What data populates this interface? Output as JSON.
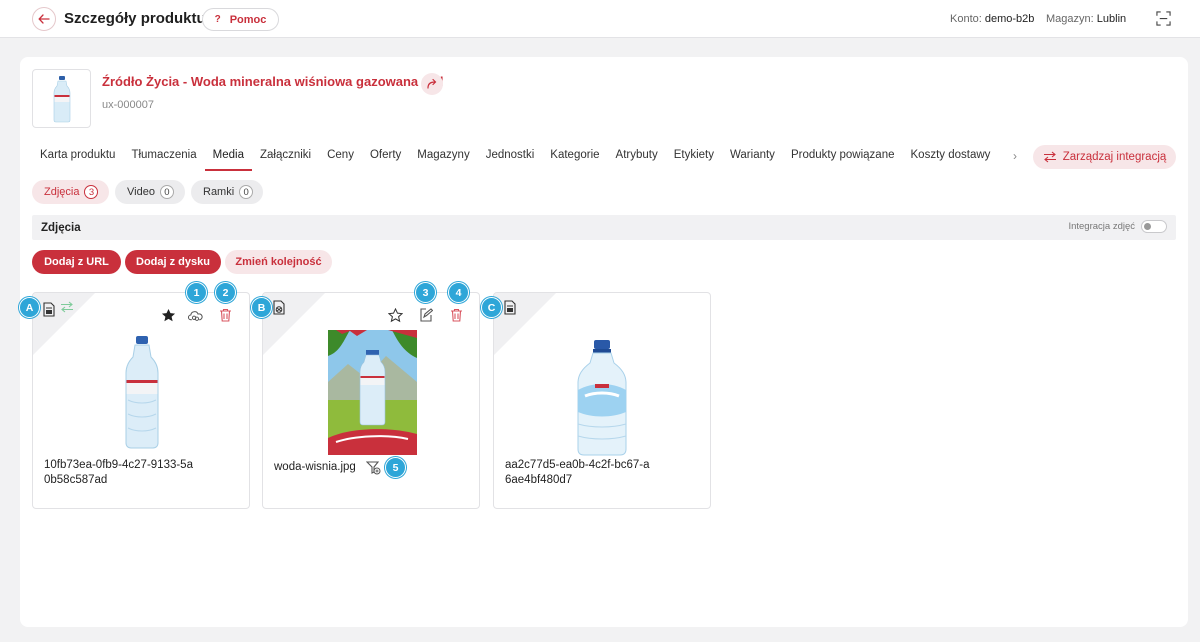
{
  "header": {
    "title": "Szczegóły produktu",
    "help_label": "Pomoc",
    "help_icon": "?",
    "account_label": "Konto:",
    "account_value": "demo-b2b",
    "warehouse_label": "Magazyn:",
    "warehouse_value": "Lublin"
  },
  "product": {
    "name": "Źródło Życia - Woda mineralna wiśniowa gazowana 1,5l",
    "sku": "ux-000007"
  },
  "tabs": [
    {
      "label": "Karta produktu"
    },
    {
      "label": "Tłumaczenia"
    },
    {
      "label": "Media"
    },
    {
      "label": "Załączniki"
    },
    {
      "label": "Ceny"
    },
    {
      "label": "Oferty"
    },
    {
      "label": "Magazyny"
    },
    {
      "label": "Jednostki"
    },
    {
      "label": "Kategorie"
    },
    {
      "label": "Atrybuty"
    },
    {
      "label": "Etykiety"
    },
    {
      "label": "Warianty"
    },
    {
      "label": "Produkty powiązane"
    },
    {
      "label": "Koszty dostawy"
    }
  ],
  "integration_button": "Zarządzaj integracją",
  "subtabs": [
    {
      "label": "Zdjęcia",
      "count": "3"
    },
    {
      "label": "Video",
      "count": "0"
    },
    {
      "label": "Ramki",
      "count": "0"
    }
  ],
  "section": {
    "title": "Zdjęcia",
    "toggle_label": "Integracja zdjęć"
  },
  "actions": {
    "add_url": "Dodaj z URL",
    "add_disk": "Dodaj z dysku",
    "reorder": "Zmień kolejność"
  },
  "media": [
    {
      "name": "10fb73ea-0fb9-4c27-9133-5a0b58c587ad",
      "marker": "A"
    },
    {
      "name": "woda-wisnia.jpg",
      "marker": "B"
    },
    {
      "name": "aa2c77d5-ea0b-4c2f-bc67-a6ae4bf480d7",
      "marker": "C"
    }
  ],
  "badges": [
    "1",
    "2",
    "3",
    "4",
    "5"
  ],
  "colors": {
    "accent": "#c9303c",
    "badge": "#2ea6d8"
  }
}
